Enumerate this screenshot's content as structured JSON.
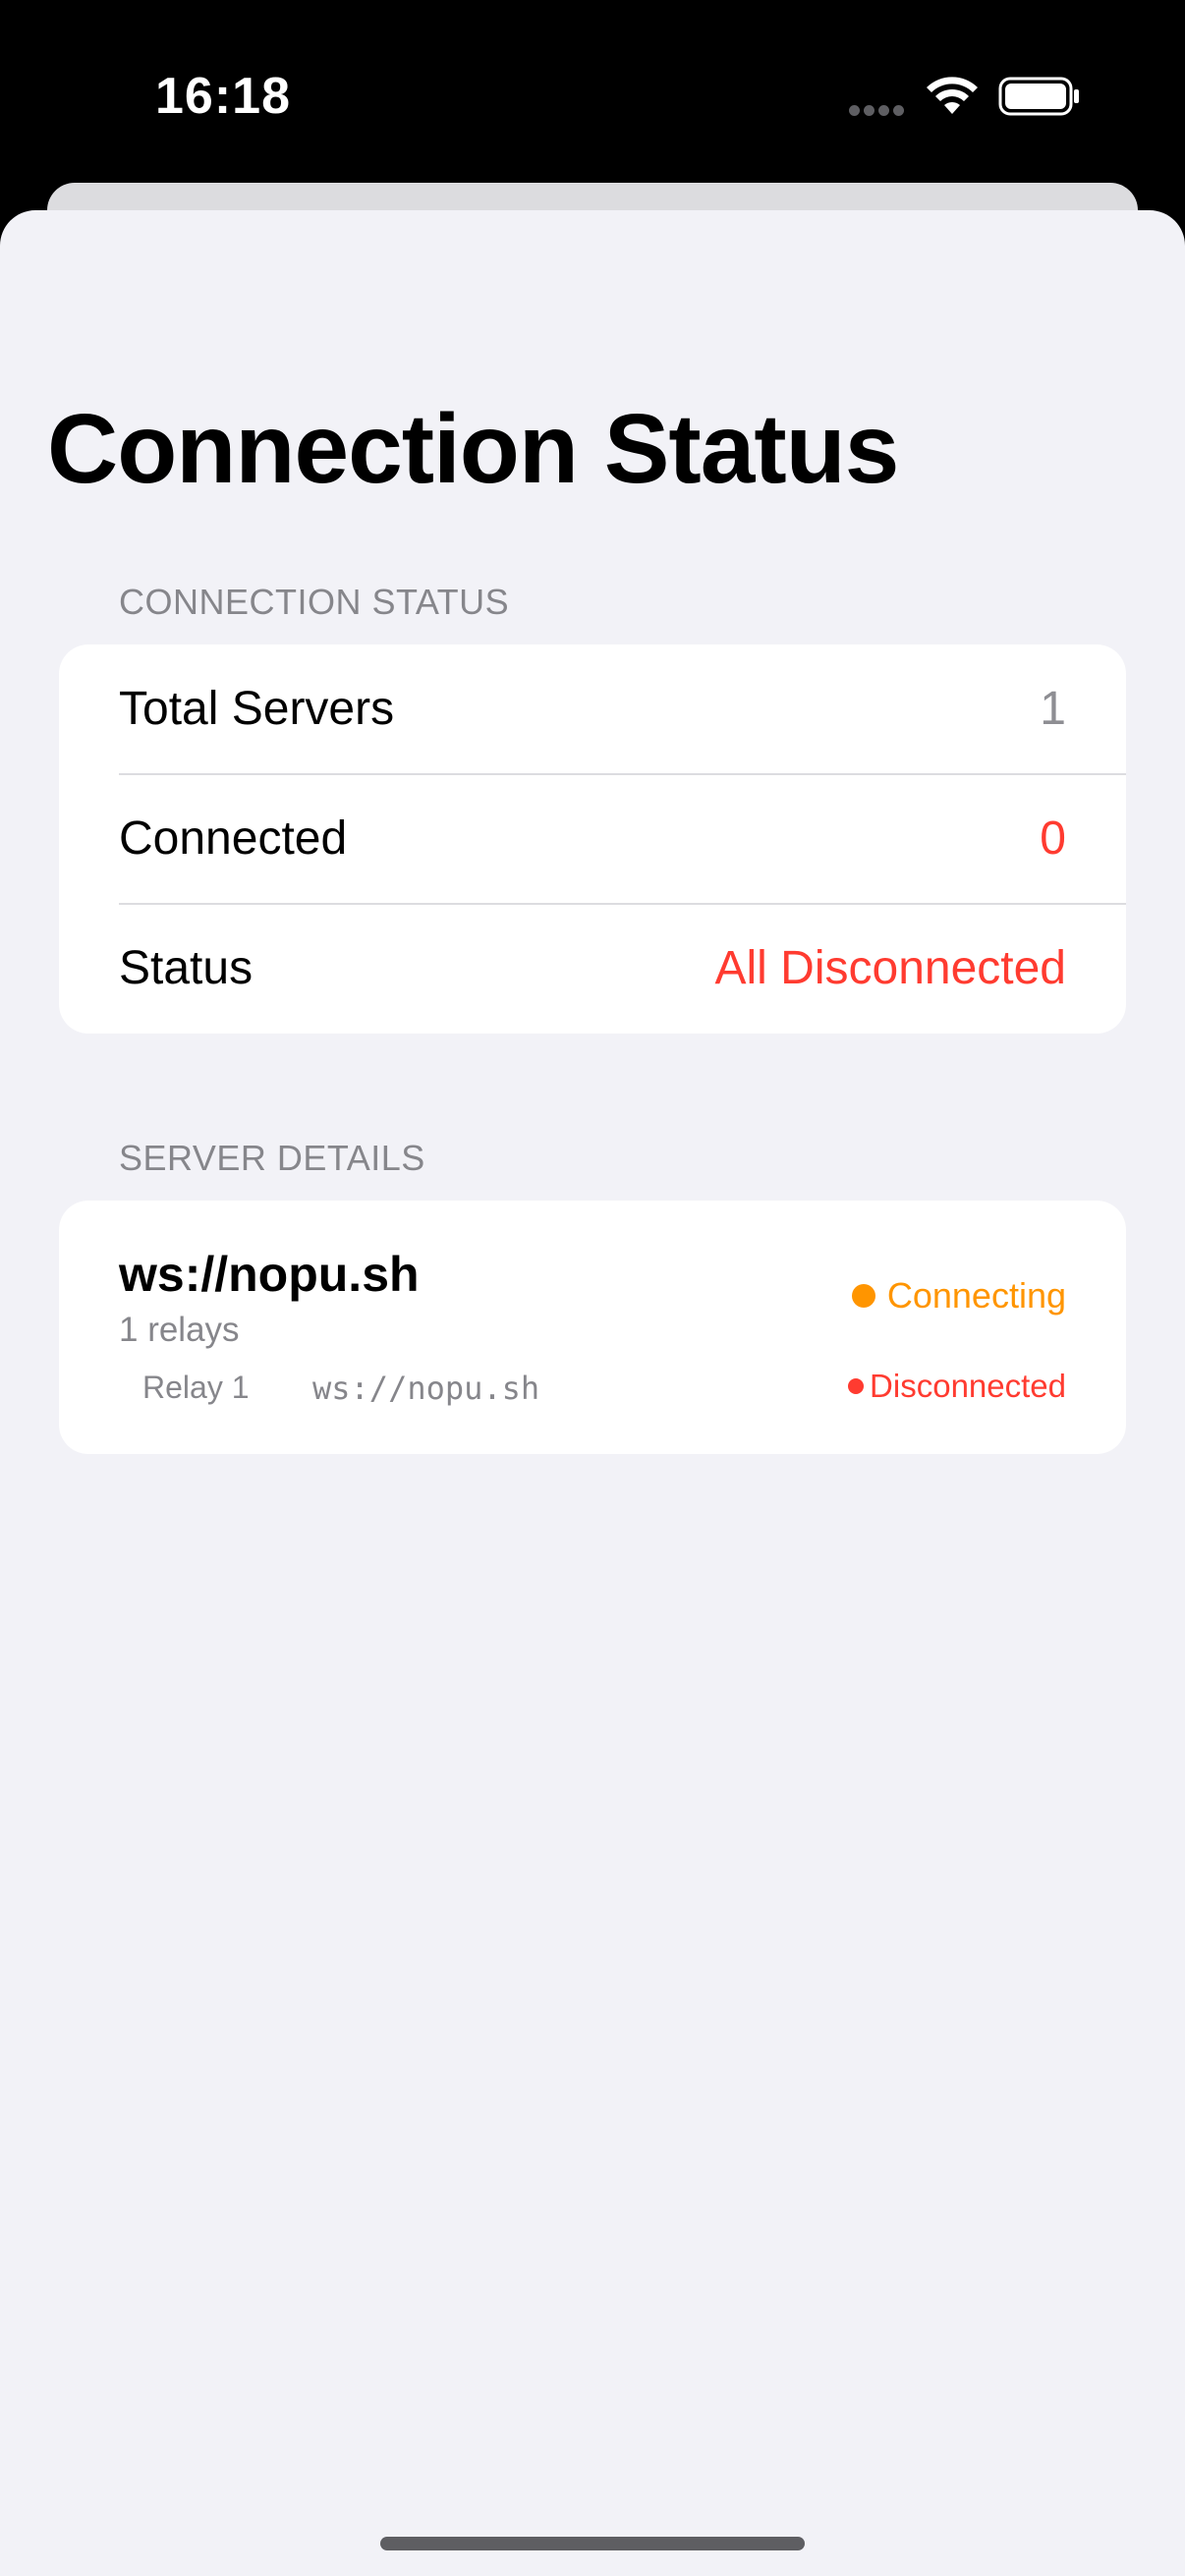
{
  "status_bar": {
    "time": "16:18",
    "icons": [
      "signal-dots-icon",
      "wifi-icon",
      "battery-icon"
    ]
  },
  "page": {
    "title": "Connection Status"
  },
  "connection_section": {
    "header": "CONNECTION STATUS",
    "rows": [
      {
        "label": "Total Servers",
        "value": "1",
        "value_color": "#8e8e93"
      },
      {
        "label": "Connected",
        "value": "0",
        "value_color": "#ff3b30"
      },
      {
        "label": "Status",
        "value": "All Disconnected",
        "value_color": "#ff3b30"
      }
    ]
  },
  "server_section": {
    "header": "SERVER DETAILS",
    "servers": [
      {
        "name": "ws://nopu.sh",
        "relay_count": "1 relays",
        "state": "Connecting",
        "state_color": "#ff9500",
        "relays": [
          {
            "label": "Relay 1",
            "url": "ws://nopu.sh",
            "state": "Disconnected",
            "state_color": "#ff3b30"
          }
        ]
      }
    ]
  },
  "colors": {
    "background": "#f2f2f7",
    "card": "#ffffff",
    "secondary_text": "#86868b",
    "red": "#ff3b30",
    "orange": "#ff9500"
  }
}
